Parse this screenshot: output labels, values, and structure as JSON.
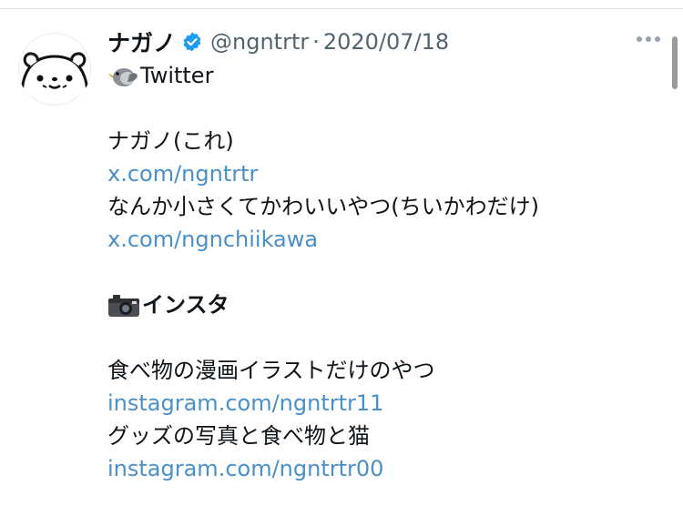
{
  "tweet": {
    "display_name": "ナガノ",
    "handle": "@ngntrtr",
    "separator": "·",
    "date": "2020/07/18",
    "lines": {
      "twitter_heading": "Twitter",
      "self_desc": "ナガノ(これ)",
      "link_1": "x.com/ngntrtr",
      "chiikawa_desc": "なんか小さくてかわいいやつ(ちいかわだけ)",
      "link_2": "x.com/ngnchiikawa",
      "insta_heading": "インスタ",
      "food_desc": "食べ物の漫画イラストだけのやつ",
      "link_3": "instagram.com/ngntrtr11",
      "goods_desc": "グッズの写真と食べ物と猫",
      "link_4": "instagram.com/ngntrtr00"
    },
    "icons": {
      "verified": "verified-badge-icon",
      "bird": "bird-emoji-icon",
      "camera": "camera-emoji-icon",
      "more": "more-options-icon"
    },
    "colors": {
      "link": "#4a90c8",
      "verified": "#1d9bf0",
      "muted": "#536471"
    }
  }
}
